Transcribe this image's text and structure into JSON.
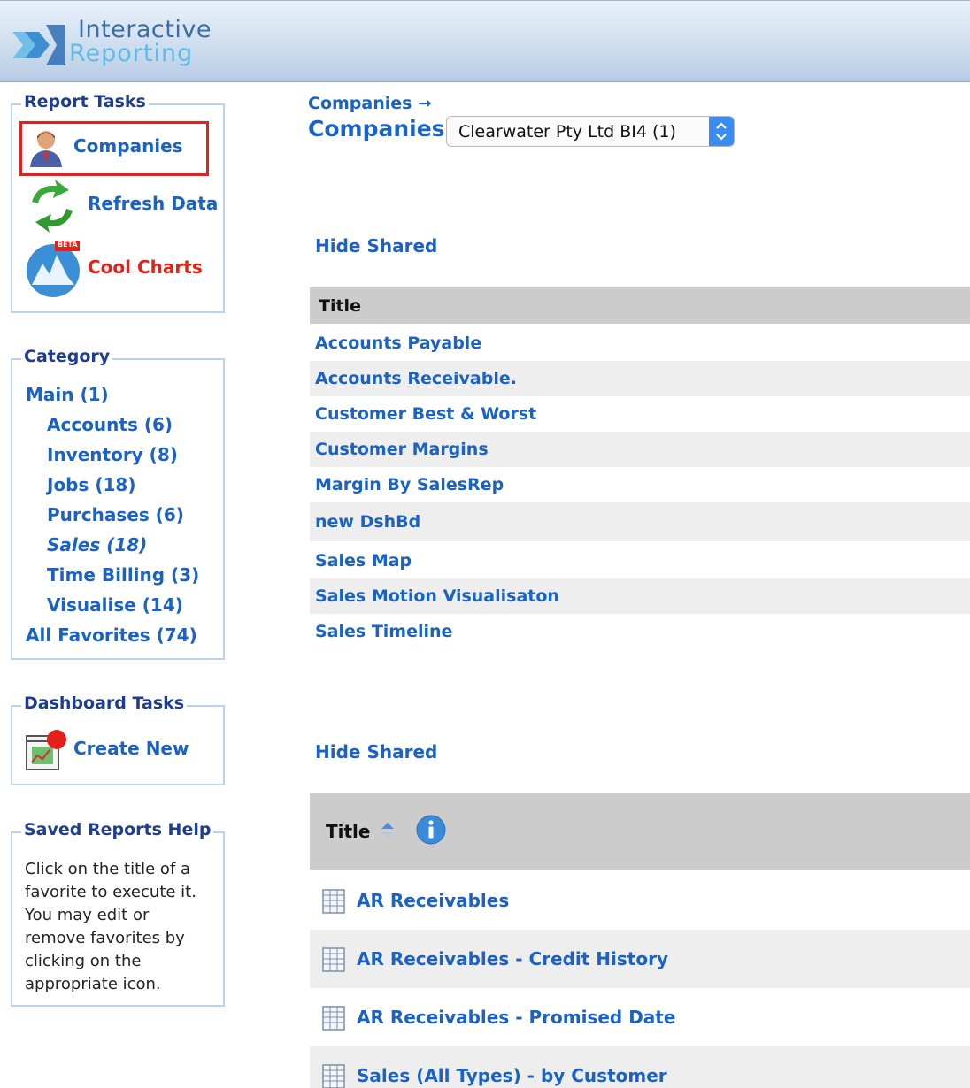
{
  "app": {
    "logo_line1": "Interactive",
    "logo_line2": "Reporting"
  },
  "report_tasks": {
    "legend": "Report Tasks",
    "items": [
      {
        "label": "Companies",
        "icon": "person-icon",
        "color": "#1a62c4"
      },
      {
        "label": "Refresh Data",
        "icon": "refresh-icon",
        "color": "#1a62c4"
      },
      {
        "label": "Cool Charts",
        "icon": "charts-icon",
        "badge": "BETA",
        "color": "#e3211a"
      }
    ]
  },
  "category": {
    "legend": "Category",
    "items": [
      {
        "label": "Main (1)",
        "level": 0
      },
      {
        "label": "Accounts (6)",
        "level": 1
      },
      {
        "label": "Inventory (8)",
        "level": 1
      },
      {
        "label": "Jobs (18)",
        "level": 1
      },
      {
        "label": "Purchases (6)",
        "level": 1
      },
      {
        "label": "Sales (18)",
        "level": 1,
        "selected": true
      },
      {
        "label": "Time Billing (3)",
        "level": 1
      },
      {
        "label": "Visualise (14)",
        "level": 1
      },
      {
        "label": "All Favorites (74)",
        "level": 0
      }
    ]
  },
  "dashboard_tasks": {
    "legend": "Dashboard Tasks",
    "create_label": "Create New"
  },
  "help": {
    "legend": "Saved Reports Help",
    "text": "Click on the title of a favorite to execute it. You may edit or remove favorites by clicking on the appropriate icon."
  },
  "main": {
    "breadcrumb": "Companies ➞",
    "title": "Companies",
    "company_select_value": "Clearwater Pty Ltd BI4 (1)",
    "hide_shared_label": "Hide Shared",
    "table1": {
      "header": "Title",
      "rows": [
        "Accounts Payable",
        "Accounts Receivable.",
        "Customer Best & Worst",
        "Customer Margins",
        "Margin By SalesRep",
        "new DshBd",
        "Sales Map",
        "Sales Motion Visualisaton",
        "Sales Timeline"
      ]
    },
    "table2": {
      "header": "Title",
      "rows": [
        "AR Receivables",
        "AR Receivables - Credit History",
        "AR Receivables - Promised Date",
        "Sales (All Types) - by Customer"
      ]
    }
  },
  "colors": {
    "link": "#1a62c4",
    "legend": "#1e3d8f",
    "highlight": "#e3211a",
    "row_alt": "#eeeeee",
    "table_header": "#cccccc"
  }
}
